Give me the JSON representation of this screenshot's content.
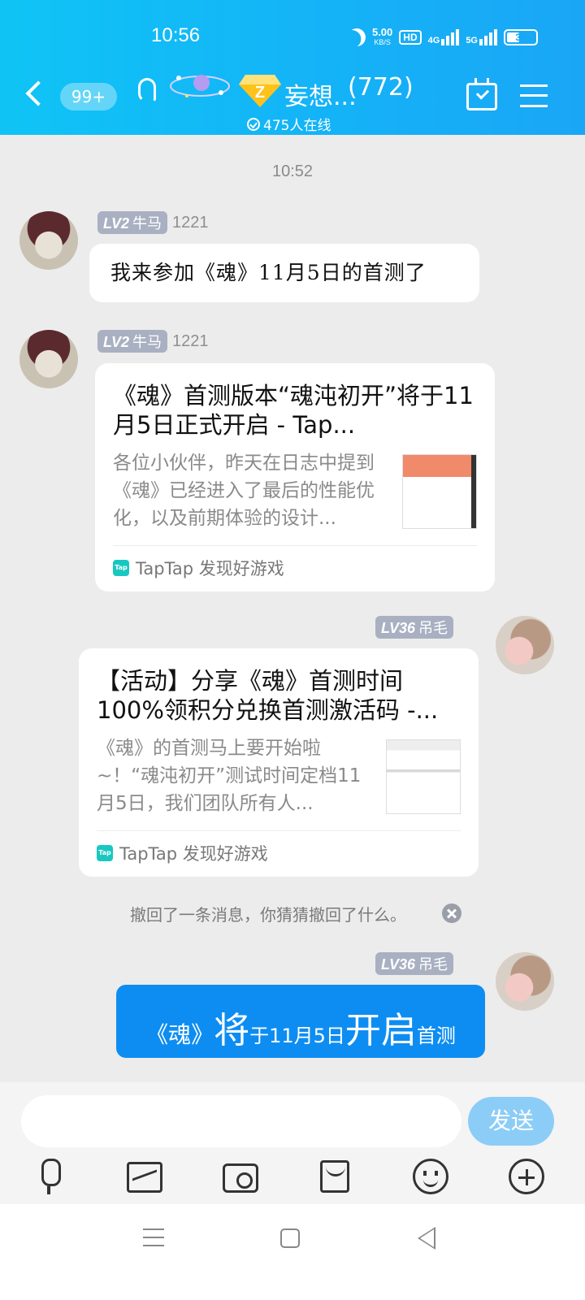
{
  "status_bar": {
    "time": "10:56",
    "net_speed": "5.00",
    "net_speed_unit": "KB/S",
    "hd_label": "HD",
    "signal1_label": "4G",
    "signal2_label": "5G",
    "battery": "39"
  },
  "header": {
    "unread_badge": "99+",
    "group_name": "妄想...",
    "member_count": "(772)",
    "online_text": "475人在线"
  },
  "chat": {
    "time_divider": "10:52",
    "messages": [
      {
        "level": "LV2",
        "title": "牛马",
        "name": "1221",
        "text": "我来参加《魂》11月5日的首测了"
      },
      {
        "level": "LV2",
        "title": "牛马",
        "name": "1221",
        "card_title": "《魂》首测版本“魂沌初开”将于11月5日正式开启 - Tap...",
        "card_desc": "各位小伙伴，昨天在日志中提到《魂》已经进入了最后的性能优化，以及前期体验的设计...",
        "card_source": "TapTap 发现好游戏"
      },
      {
        "level": "LV36",
        "title": "吊毛",
        "card_title": "【活动】分享《魂》首测时间100%领积分兑换首测激活码 -...",
        "card_desc": "《魂》的首测马上要开始啦~！“魂沌初开”测试时间定档11月5日，我们团队所有人...",
        "card_source": "TapTap 发现好游戏"
      }
    ],
    "recall_notice": "撤回了一条消息，你猜猜撤回了什么。",
    "last_message": {
      "level": "LV36",
      "title": "吊毛",
      "part1": "《魂》",
      "part2": "将",
      "part3": "于11月5日",
      "part4": "开启",
      "part5": "首测"
    }
  },
  "input": {
    "value": "",
    "send_label": "发送"
  },
  "tap_icon_label": "Tap",
  "colors": {
    "header": "#14b3f7",
    "bubble_blue": "#0d8df2",
    "send_button": "#8ccdf7"
  },
  "icons": [
    "back-icon",
    "ear-icon",
    "calendar-check-icon",
    "menu-icon",
    "mic-icon",
    "image-icon",
    "camera-icon",
    "redpacket-icon",
    "emoji-icon",
    "plus-icon"
  ]
}
